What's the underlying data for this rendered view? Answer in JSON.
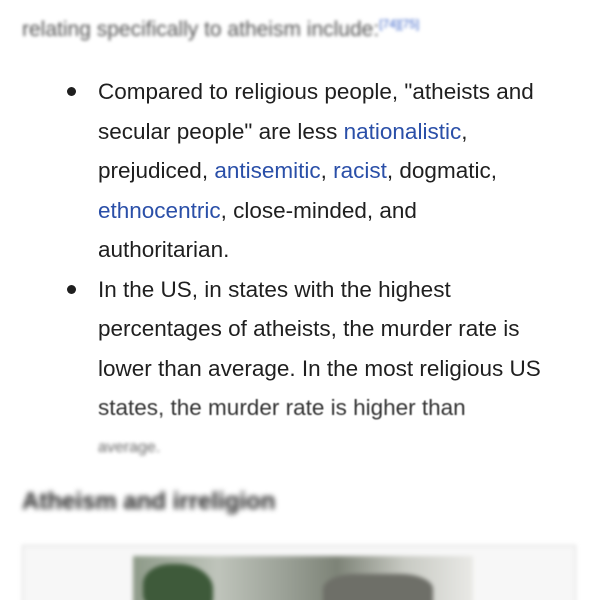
{
  "intro": {
    "text": "relating specifically to atheism include:",
    "refs": "[74][75]"
  },
  "bullets": [
    {
      "line1_a": "Compared to religious people, \"atheists and",
      "line2_a": "secular people\" are less ",
      "link_nationalistic": "nationalistic",
      "line2_b": ",",
      "line3_a": "prejudiced, ",
      "link_antisemitic": "antisemitic",
      "line3_b": ", ",
      "link_racist": "racist",
      "line3_c": ", dogmatic,",
      "link_ethnocentric": "ethnocentric",
      "line4_b": ", close-minded, and",
      "line5": "authoritarian."
    },
    {
      "line1": "In the US, in states with the highest",
      "line2": "percentages of atheists, the murder rate is",
      "line3": "lower than average. In the most religious US",
      "line4": "states, the murder rate is higher than",
      "line5": "average."
    }
  ],
  "section": {
    "heading": "Atheism and irreligion"
  },
  "colors": {
    "link": "#2a4fa8",
    "text": "#1f1f1f"
  }
}
